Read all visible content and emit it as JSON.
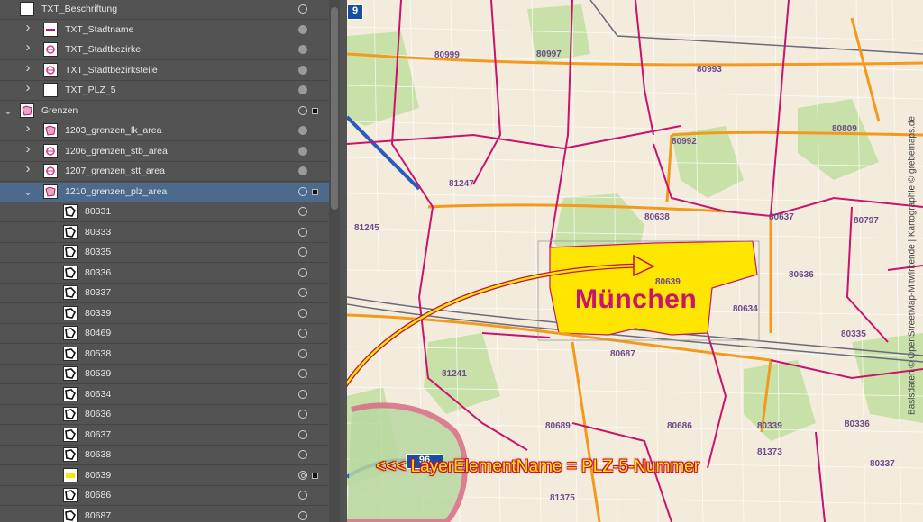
{
  "layers_panel": {
    "rows": [
      {
        "label": "TXT_Beschriftung",
        "level": 0,
        "expand": "none",
        "thumb": "blank",
        "target": "hollow"
      },
      {
        "label": "TXT_Stadtname",
        "level": 1,
        "expand": "collapsed",
        "thumb": "stroke",
        "target": "filled"
      },
      {
        "label": "TXT_Stadtbezirke",
        "level": 1,
        "expand": "collapsed",
        "thumb": "pink",
        "target": "filled"
      },
      {
        "label": "TXT_Stadtbezirksteile",
        "level": 1,
        "expand": "collapsed",
        "thumb": "pink",
        "target": "filled"
      },
      {
        "label": "TXT_PLZ_5",
        "level": 1,
        "expand": "collapsed",
        "thumb": "blank",
        "target": "filled"
      },
      {
        "label": "Grenzen",
        "level": 0,
        "expand": "expanded",
        "thumb": "pinkmap",
        "target": "hollow",
        "square": true
      },
      {
        "label": "1203_grenzen_lk_area",
        "level": 1,
        "expand": "collapsed",
        "thumb": "pinkmap",
        "target": "filled"
      },
      {
        "label": "1206_grenzen_stb_area",
        "level": 1,
        "expand": "collapsed",
        "thumb": "pink",
        "target": "filled"
      },
      {
        "label": "1207_grenzen_stt_area",
        "level": 1,
        "expand": "collapsed",
        "thumb": "pink",
        "target": "filled"
      },
      {
        "label": "1210_grenzen_plz_area",
        "level": 1,
        "expand": "expanded",
        "thumb": "pinkmap",
        "target": "hollow",
        "square": true,
        "selected": true
      },
      {
        "label": "80331",
        "level": 2,
        "thumb": "shape",
        "target": "hollow"
      },
      {
        "label": "80333",
        "level": 2,
        "thumb": "shape",
        "target": "hollow"
      },
      {
        "label": "80335",
        "level": 2,
        "thumb": "shape",
        "target": "hollow"
      },
      {
        "label": "80336",
        "level": 2,
        "thumb": "shape",
        "target": "hollow"
      },
      {
        "label": "80337",
        "level": 2,
        "thumb": "shape",
        "target": "hollow"
      },
      {
        "label": "80339",
        "level": 2,
        "thumb": "shape",
        "target": "hollow"
      },
      {
        "label": "80469",
        "level": 2,
        "thumb": "shape",
        "target": "hollow"
      },
      {
        "label": "80538",
        "level": 2,
        "thumb": "shape",
        "target": "hollow"
      },
      {
        "label": "80539",
        "level": 2,
        "thumb": "shape",
        "target": "hollow"
      },
      {
        "label": "80634",
        "level": 2,
        "thumb": "shape",
        "target": "hollow"
      },
      {
        "label": "80636",
        "level": 2,
        "thumb": "shape",
        "target": "hollow"
      },
      {
        "label": "80637",
        "level": 2,
        "thumb": "shape",
        "target": "hollow"
      },
      {
        "label": "80638",
        "level": 2,
        "thumb": "shape",
        "target": "hollow"
      },
      {
        "label": "80639",
        "level": 2,
        "thumb": "yellow",
        "target": "double",
        "square": true
      },
      {
        "label": "80686",
        "level": 2,
        "thumb": "shape",
        "target": "hollow"
      },
      {
        "label": "80687",
        "level": 2,
        "thumb": "shape",
        "target": "hollow"
      }
    ]
  },
  "map": {
    "city_name": "München",
    "attribution": "Basisdaten © OpenStreetMap-Mitwirkende | Kartographie © grebemaps.de",
    "callout": "<<< LayerElementName = PLZ-5-Nummer",
    "road_shields": [
      {
        "label": "96"
      },
      {
        "label": "9"
      }
    ],
    "postcodes": [
      "80999",
      "80997",
      "80993",
      "80992",
      "80809",
      "81247",
      "80638",
      "80637",
      "80797",
      "81245",
      "80639",
      "80636",
      "80634",
      "80335",
      "80687",
      "81241",
      "80339",
      "80336",
      "80689",
      "80686",
      "81373",
      "81375",
      "80337"
    ],
    "colors": {
      "highlight": "#ffe600",
      "border": "#c8146e",
      "road": "#f39a1e",
      "park": "#c8e1a8"
    }
  }
}
